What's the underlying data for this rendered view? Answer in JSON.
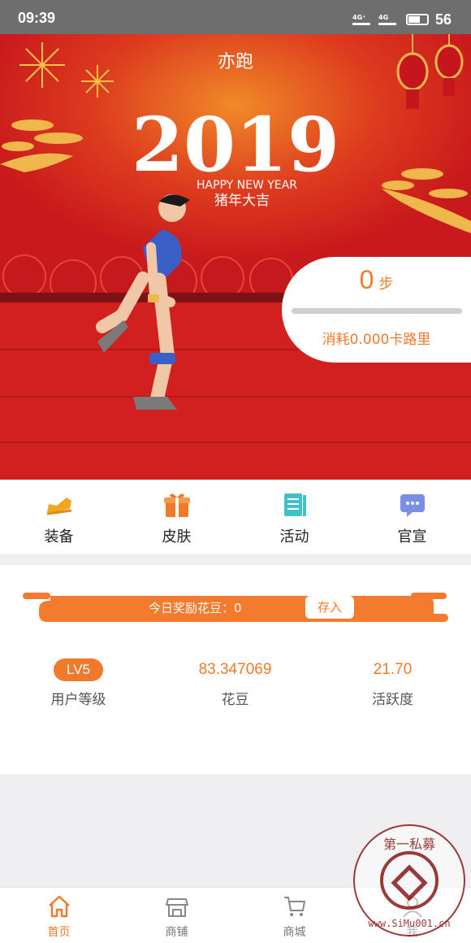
{
  "status_bar": {
    "time": "09:39",
    "signal_1": "4G⁺",
    "signal_2": "4G",
    "battery": "56"
  },
  "header": {
    "title": "亦跑"
  },
  "banner": {
    "year": "2019",
    "greeting_en": "HAPPY NEW YEAR",
    "greeting_cn": "猪年大吉"
  },
  "step_card": {
    "steps": "0",
    "steps_unit": "步",
    "progress": 0,
    "calories": "消耗0.000卡路里"
  },
  "menu": [
    {
      "label": "装备",
      "icon": "sneaker-icon"
    },
    {
      "label": "皮肤",
      "icon": "gift-icon"
    },
    {
      "label": "活动",
      "icon": "document-icon"
    },
    {
      "label": "官宣",
      "icon": "chat-icon"
    }
  ],
  "reward": {
    "text": "今日奖励花豆：0",
    "button": "存入"
  },
  "stats": {
    "level": {
      "value": "LV5",
      "label": "用户等级"
    },
    "beans": {
      "value": "83.347069",
      "label": "花豆"
    },
    "activity": {
      "value": "21.70",
      "label": "活跃度"
    }
  },
  "tabs": [
    {
      "label": "首页",
      "icon": "home-icon",
      "active": true
    },
    {
      "label": "商铺",
      "icon": "store-icon",
      "active": false
    },
    {
      "label": "商城",
      "icon": "cart-icon",
      "active": false
    },
    {
      "label": "我",
      "icon": "user-icon",
      "active": false
    }
  ],
  "watermark": {
    "top_text": "第一私募",
    "bottom_text": "www.SiMu001.cn"
  },
  "colors": {
    "accent": "#f07a2c",
    "hero_red": "#d1201f",
    "status_gray": "#6e6e6e"
  }
}
